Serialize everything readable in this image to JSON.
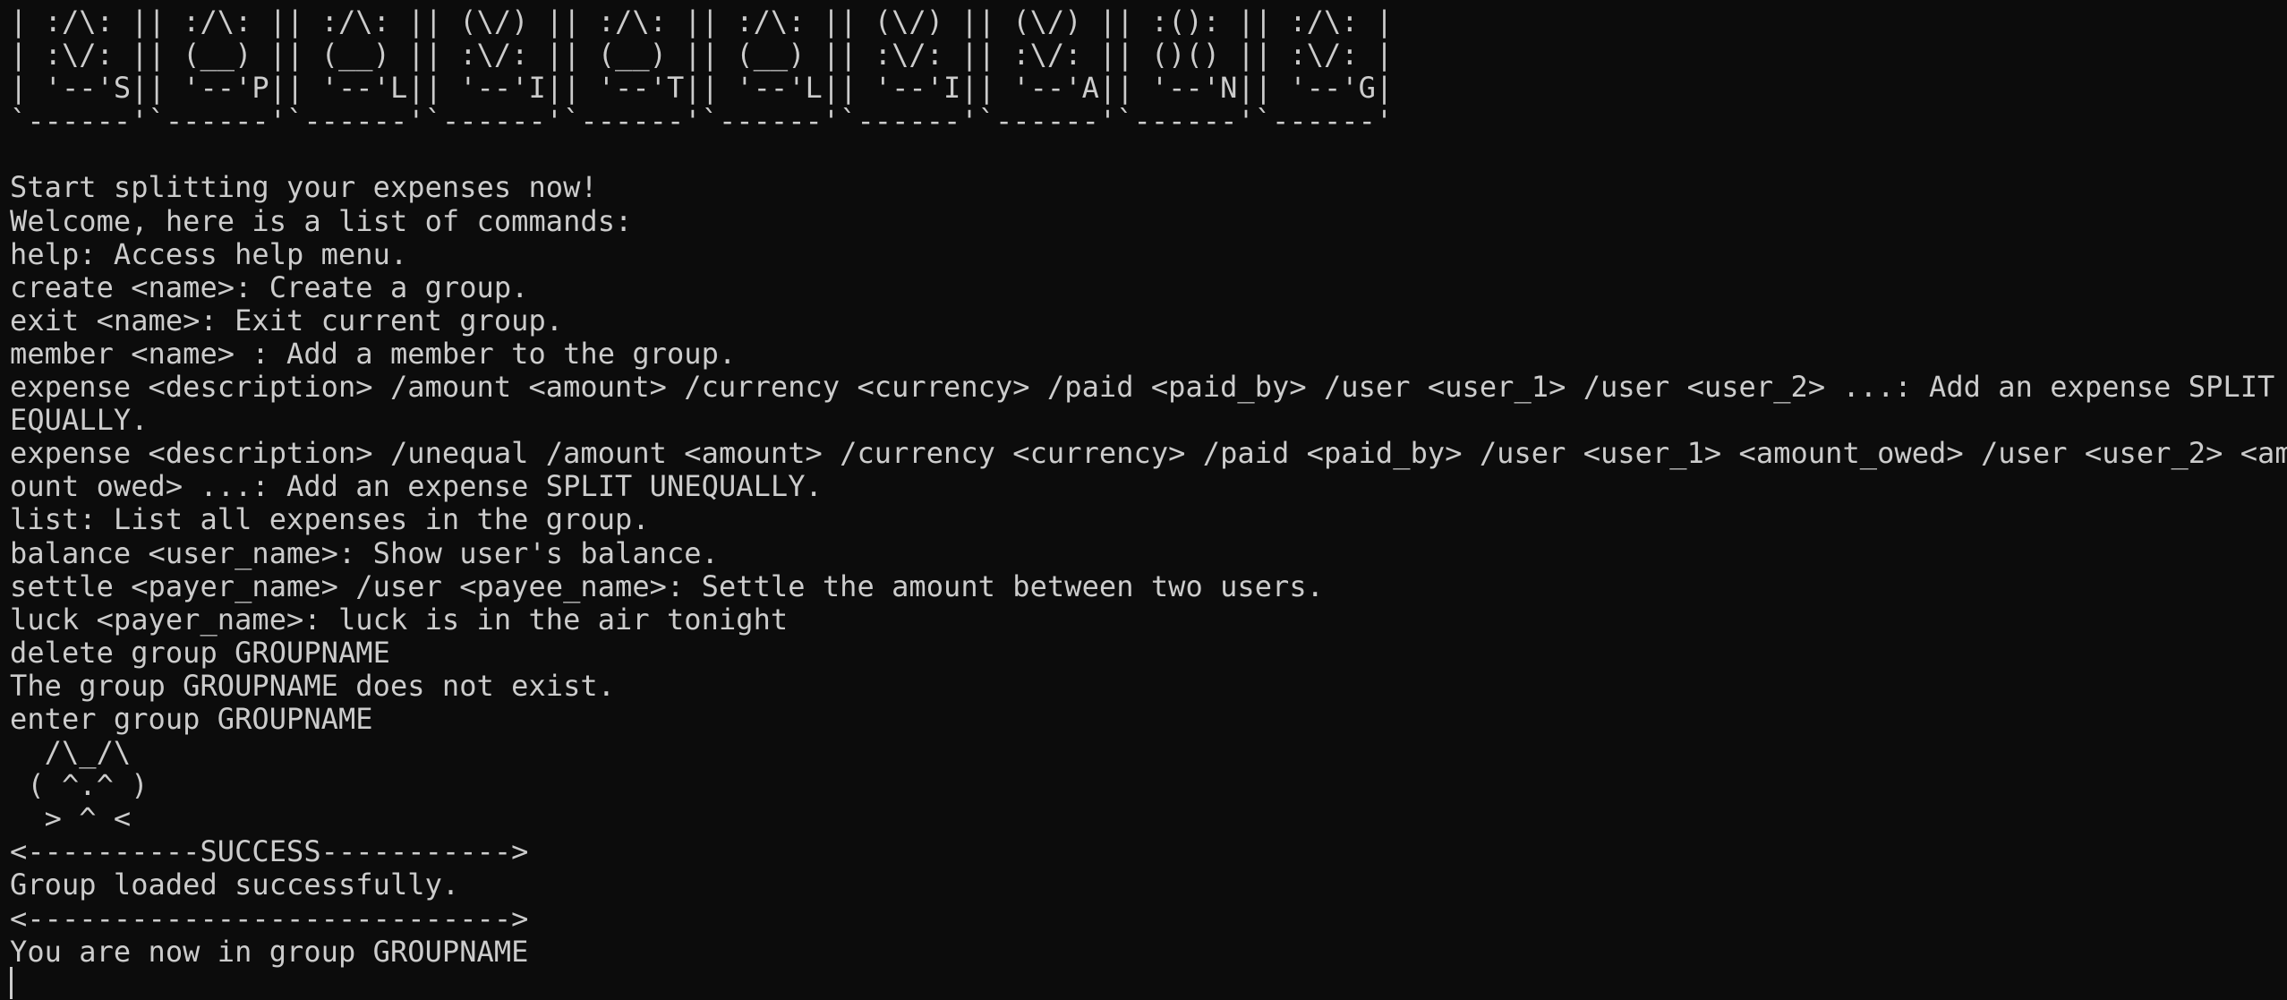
{
  "terminal": {
    "lines": [
      "| :/\\: || :/\\: || :/\\: || (\\/) || :/\\: || :/\\: || (\\/) || (\\/) || :(): || :/\\: |",
      "| :\\/: || (__) || (__) || :\\/: || (__) || (__) || :\\/: || :\\/: || ()() || :\\/: |",
      "| '--'S|| '--'P|| '--'L|| '--'I|| '--'T|| '--'L|| '--'I|| '--'A|| '--'N|| '--'G|",
      "`------'`------'`------'`------'`------'`------'`------'`------'`------'`------'",
      "",
      "Start splitting your expenses now!",
      "Welcome, here is a list of commands:",
      "help: Access help menu.",
      "create <name>: Create a group.",
      "exit <name>: Exit current group.",
      "member <name> : Add a member to the group.",
      "expense <description> /amount <amount> /currency <currency> /paid <paid_by> /user <user_1> /user <user_2> ...: Add an expense SPLIT",
      "EQUALLY.",
      "expense <description> /unequal /amount <amount> /currency <currency> /paid <paid_by> /user <user_1> <amount_owed> /user <user_2> <am",
      "ount owed> ...: Add an expense SPLIT UNEQUALLY.",
      "list: List all expenses in the group.",
      "balance <user_name>: Show user's balance.",
      "settle <payer_name> /user <payee_name>: Settle the amount between two users.",
      "luck <payer_name>: luck is in the air tonight",
      "delete group GROUPNAME",
      "The group GROUPNAME does not exist.",
      "enter group GROUPNAME",
      "  /\\_/\\",
      " ( ^.^ )",
      "  > ^ <",
      "<----------SUCCESS----------->",
      "Group loaded successfully.",
      "<---------------------------->",
      "You are now in group GROUPNAME"
    ]
  },
  "colors": {
    "background": "#0c0c0c",
    "foreground": "#cccccc"
  }
}
